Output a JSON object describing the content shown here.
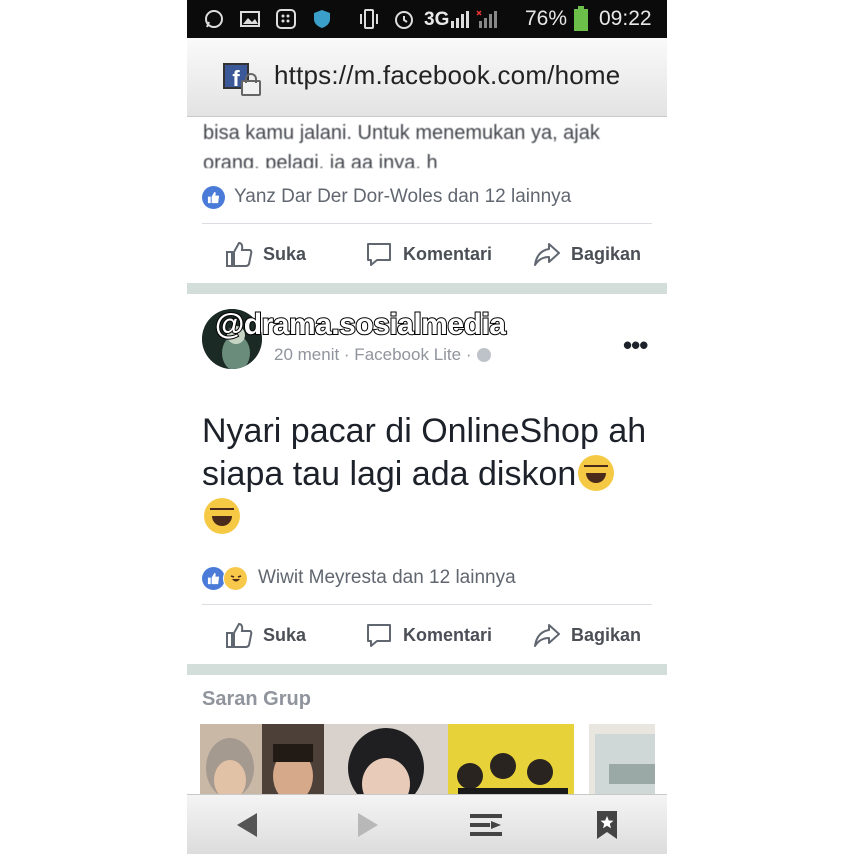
{
  "status_bar": {
    "network": "3G",
    "battery": "76%",
    "time": "09:22",
    "battery_color": "#6cc04a"
  },
  "browser": {
    "url": "https://m.facebook.com/home",
    "favicon_letter": "f"
  },
  "feed": {
    "clipped_post_text_line1": "bisa kamu jalani. Untuk menemukan ya, ajak",
    "clipped_post_text_line2": "orang. pelagi. ja aa inya. h",
    "post1_reactions": "Yanz Dar Der Dor-Woles dan 12 lainnya",
    "actions": {
      "like": "Suka",
      "comment": "Komentari",
      "share": "Bagikan"
    },
    "post2": {
      "author": "@drama.sosialmedia",
      "meta": "20 menit · Facebook Lite ·",
      "more": "•••",
      "text": "Nyari pacar di OnlineShop ah siapa tau lagi ada diskon",
      "emoji": "😂😂",
      "reactions": "Wiwit Meyresta dan 12 lainnya"
    },
    "suggested_groups_title": "Saran Grup"
  },
  "colors": {
    "facebook_blue": "#3b5998",
    "like_blue": "#4a7bd9",
    "separator": "#d3dedb",
    "meta_gray": "#90949c"
  },
  "icons": [
    "whatsapp-icon",
    "gallery-icon",
    "bbm-icon",
    "shield-icon",
    "vibrate-icon",
    "alarm-icon",
    "signal-icon",
    "battery-icon",
    "lock-icon",
    "like-icon",
    "comment-icon",
    "share-icon",
    "globe-icon",
    "back-icon",
    "forward-icon",
    "menu-icon",
    "bookmark-icon"
  ]
}
